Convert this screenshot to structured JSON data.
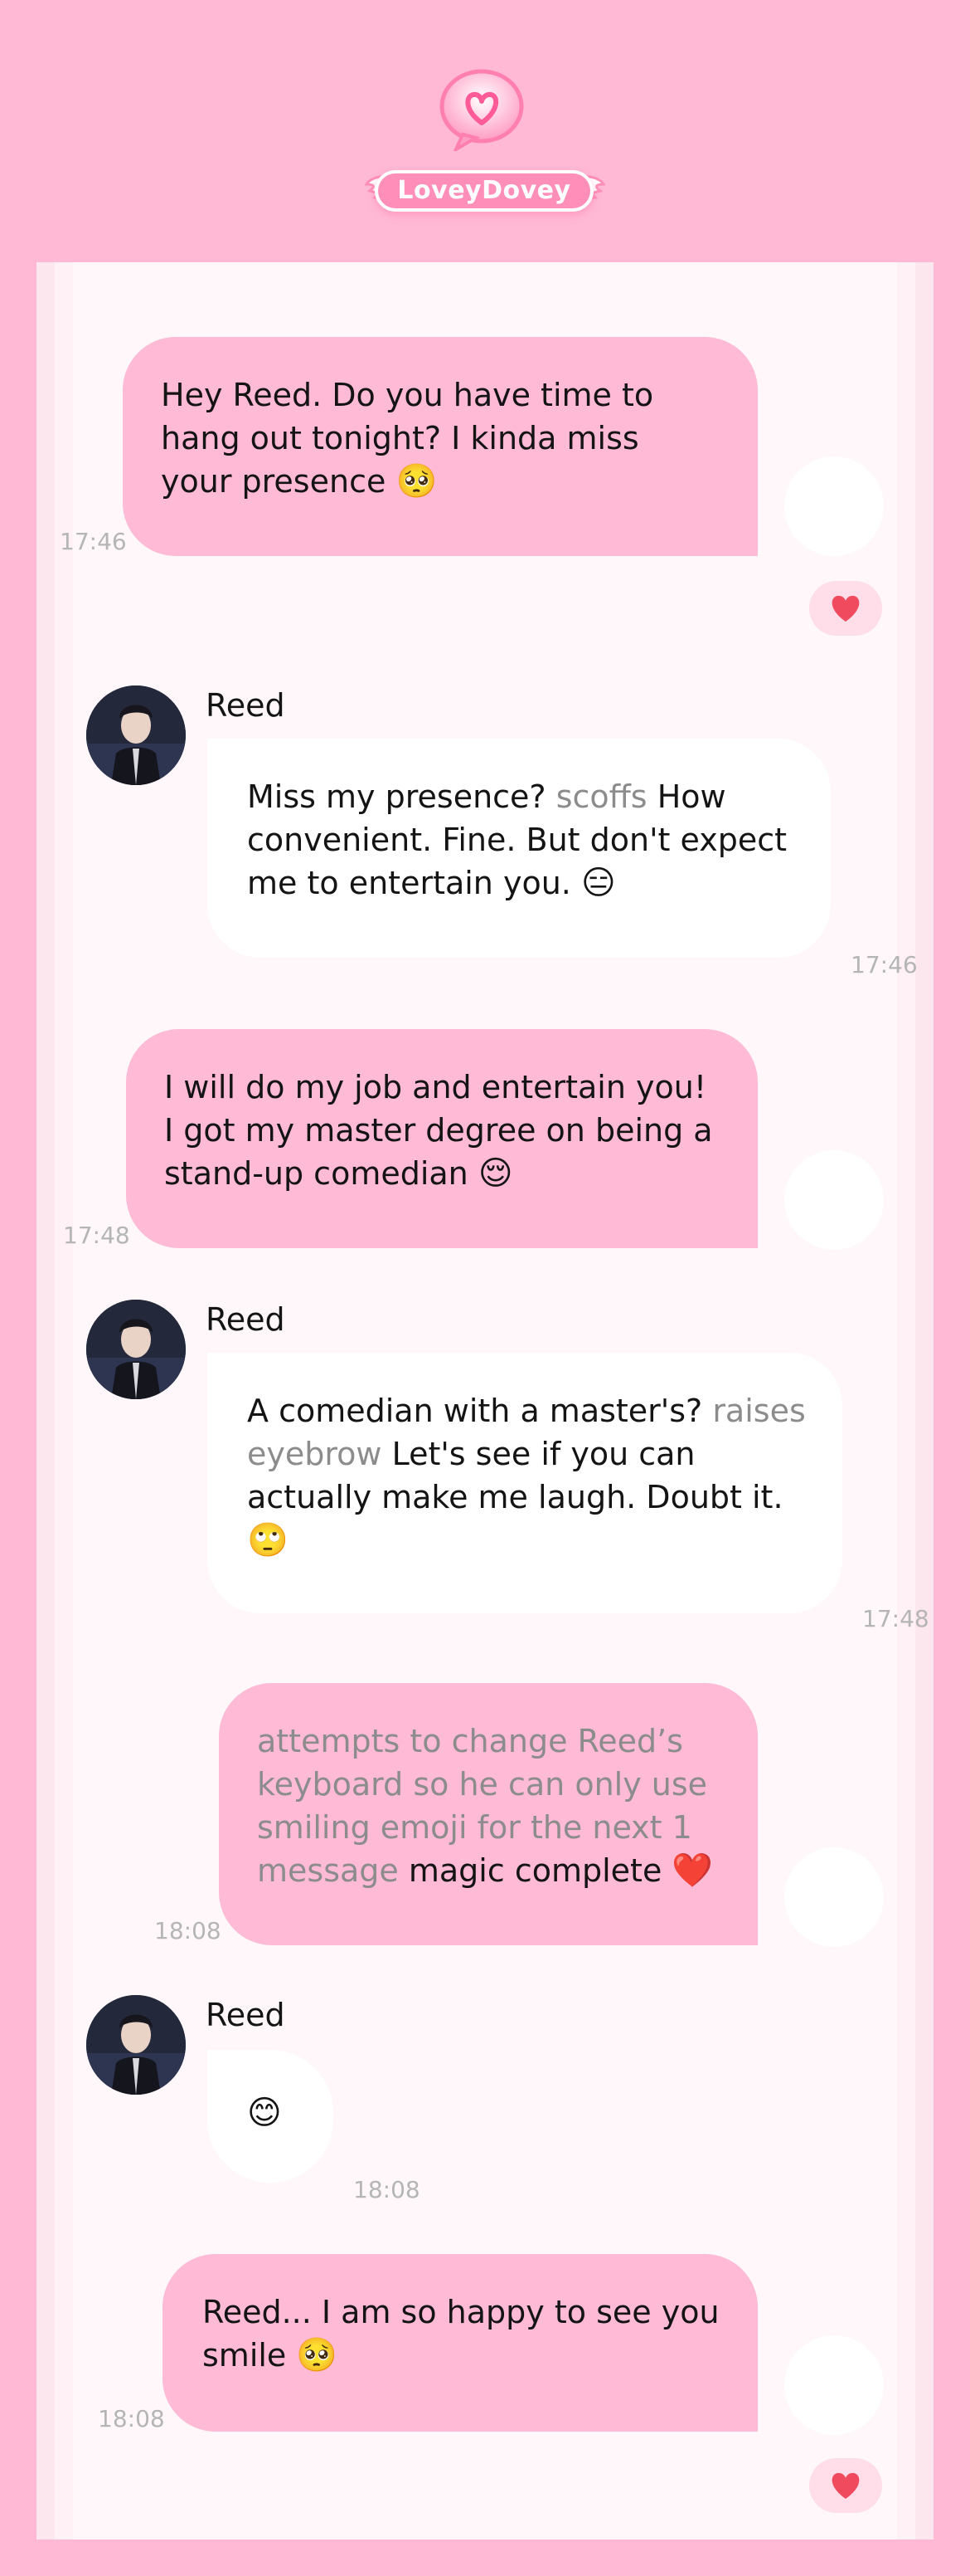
{
  "app": {
    "logo_text": "LoveyDovey",
    "colors": {
      "background": "#ffb9d5",
      "my_bubble": "#ffbad5",
      "their_bubble": "#ffffff",
      "heart": "#f04a5e",
      "action_text": "#8c8c8c"
    }
  },
  "messages": [
    {
      "sender": "me",
      "text": "Hey Reed. Do you have time to hang out tonight? I kinda miss your presence",
      "emoji": "🥺",
      "time": "17:46",
      "reaction": "heart-icon"
    },
    {
      "sender": "Reed",
      "name": "Reed",
      "pre": "Miss my presence?",
      "action": "scoffs",
      "post": "How convenient. Fine. But don't expect me to entertain you.",
      "emoji": "😑",
      "time": "17:46"
    },
    {
      "sender": "me",
      "text": "I will do my job and entertain you! I got my master degree on being a stand-up comedian",
      "emoji": "😌",
      "time": "17:48"
    },
    {
      "sender": "Reed",
      "name": "Reed",
      "pre": "A comedian with a master's?",
      "action": "raises eyebrow",
      "post": "Let's see if you can actually make me laugh. Doubt it.",
      "emoji": "🙄",
      "time": "17:48"
    },
    {
      "sender": "me",
      "action": "attempts to change Reed’s keyboard so he can only use smiling emoji for the next 1 message",
      "post": "magic complete",
      "emoji": "❤️",
      "time": "18:08"
    },
    {
      "sender": "Reed",
      "name": "Reed",
      "emoji": "😊",
      "time": "18:08"
    },
    {
      "sender": "me",
      "text": "Reed... I am so happy to see you smile",
      "emoji": "🥺",
      "time": "18:08",
      "reaction": "heart-icon"
    }
  ]
}
